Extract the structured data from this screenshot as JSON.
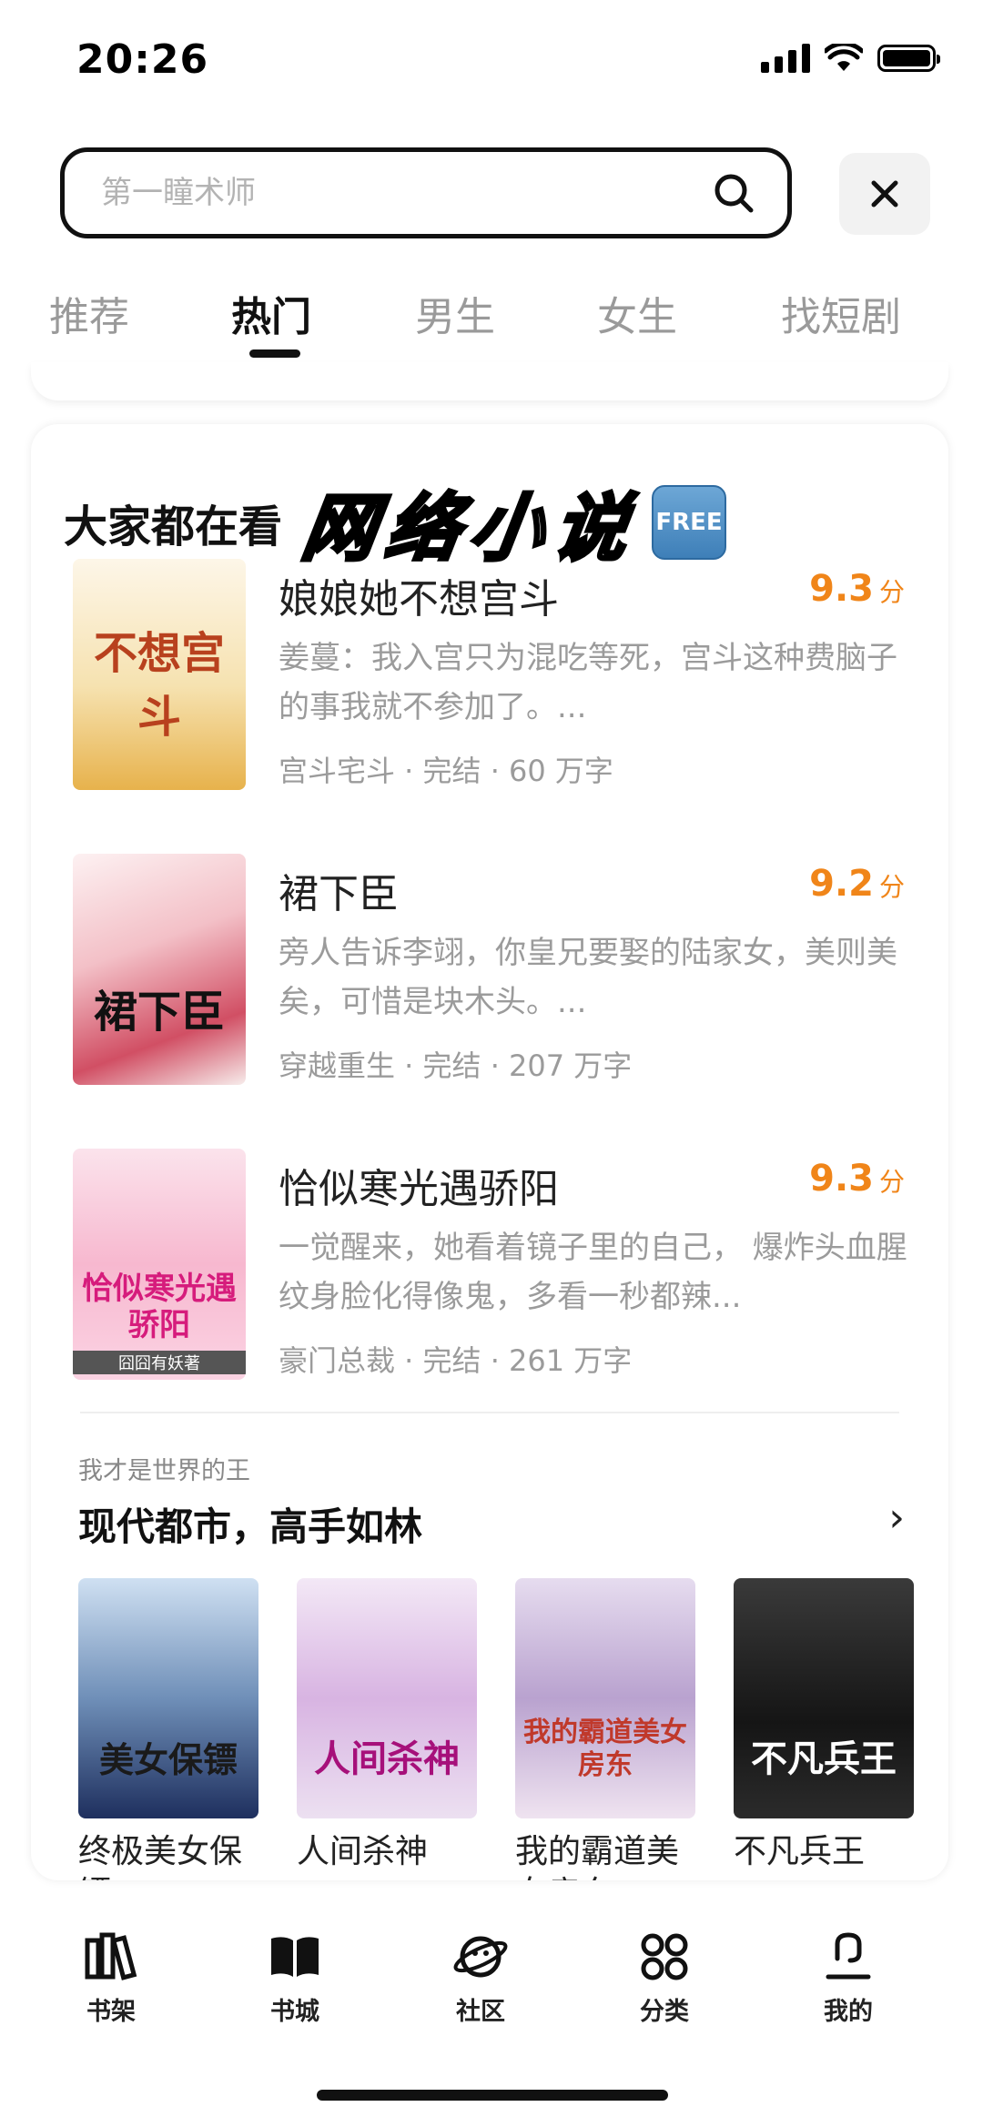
{
  "status_bar": {
    "time": "20:26"
  },
  "search": {
    "placeholder": "第一瞳术师"
  },
  "tabs": [
    {
      "label": "推荐",
      "active": false
    },
    {
      "label": "热门",
      "active": true
    },
    {
      "label": "男生",
      "active": false
    },
    {
      "label": "女生",
      "active": false
    },
    {
      "label": "找短剧",
      "active": false
    }
  ],
  "card": {
    "title": "大家都在看",
    "highlight": "网络小说",
    "badge": "FREE",
    "books": [
      {
        "title": "娘娘她不想宫斗",
        "score": "9.3",
        "score_unit": "分",
        "desc": "姜蔓：我入宫只为混吃等死，宫斗这种费脑子的事我就不参加了。...",
        "meta": "宫斗宅斗 · 完结 · 60 万字",
        "cover_text": "不想宫斗",
        "cover_color": "#e8b348"
      },
      {
        "title": "裙下臣",
        "score": "9.2",
        "score_unit": "分",
        "desc": "旁人告诉李翊，你皇兄要娶的陆家女，美则美矣，可惜是块木头。...",
        "meta": "穿越重生 · 完结 · 207 万字",
        "cover_text": "裙下臣",
        "cover_color": "#c43b4e"
      },
      {
        "title": "恰似寒光遇骄阳",
        "score": "9.3",
        "score_unit": "分",
        "desc": "一觉醒来，她看着镜子里的自己， 爆炸头血腥纹身脸化得像鬼，多看一秒都辣...",
        "meta": "豪门总裁 · 完结 · 261 万字",
        "cover_text": "恰似寒光遇骄阳",
        "cover_author": "囧囧有妖著",
        "cover_color": "#e7529a"
      }
    ],
    "section": {
      "subtitle": "我才是世界的王",
      "title": "现代都市，高手如林",
      "arrow": "›",
      "items": [
        {
          "title": "终极美女保镖",
          "cover_text": "美女保镖",
          "cover_color": "#2b3f73"
        },
        {
          "title": "人间杀神",
          "cover_text": "人间杀神",
          "cover_color": "#b0227a"
        },
        {
          "title": "我的霸道美女房东",
          "cover_text": "我的霸道美女房东",
          "cover_color": "#c0392b"
        },
        {
          "title": "不凡兵王",
          "cover_text": "不凡兵王",
          "cover_color": "#ffffff"
        }
      ]
    }
  },
  "bottom_nav": [
    {
      "label": "书架",
      "icon": "bookshelf-icon"
    },
    {
      "label": "书城",
      "icon": "book-open-icon"
    },
    {
      "label": "社区",
      "icon": "planet-icon"
    },
    {
      "label": "分类",
      "icon": "grid-icon"
    },
    {
      "label": "我的",
      "icon": "profile-icon"
    }
  ]
}
